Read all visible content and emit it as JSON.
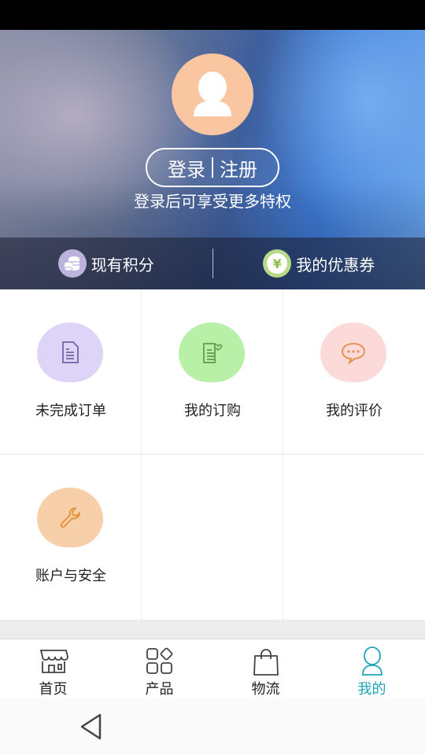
{
  "header": {
    "login_label": "登录",
    "register_label": "注册",
    "subtitle": "登录后可享受更多特权",
    "points_label": "现有积分",
    "coupon_label": "我的优惠券",
    "coupon_symbol": "¥"
  },
  "menu": [
    {
      "label": "未完成订单",
      "icon": "document-icon",
      "bg": "#ddd4f7",
      "color": "#7d6fb0"
    },
    {
      "label": "我的订购",
      "icon": "heart-document-icon",
      "bg": "#b8f0a8",
      "color": "#6aa55c"
    },
    {
      "label": "我的评价",
      "icon": "chat-bubble-icon",
      "bg": "#fbdad9",
      "color": "#e5934f"
    },
    {
      "label": "账户与安全",
      "icon": "wrench-icon",
      "bg": "#f7d0aa",
      "color": "#e8953f"
    }
  ],
  "tabs": [
    {
      "label": "首页",
      "icon": "shop-icon",
      "active": false
    },
    {
      "label": "产品",
      "icon": "apps-icon",
      "active": false
    },
    {
      "label": "物流",
      "icon": "shopping-bag-icon",
      "active": false
    },
    {
      "label": "我的",
      "icon": "person-icon",
      "active": true
    }
  ],
  "colors": {
    "accent": "#1fa5b8",
    "avatar_bg": "#f9c6a1",
    "tab_inactive": "#222222"
  }
}
